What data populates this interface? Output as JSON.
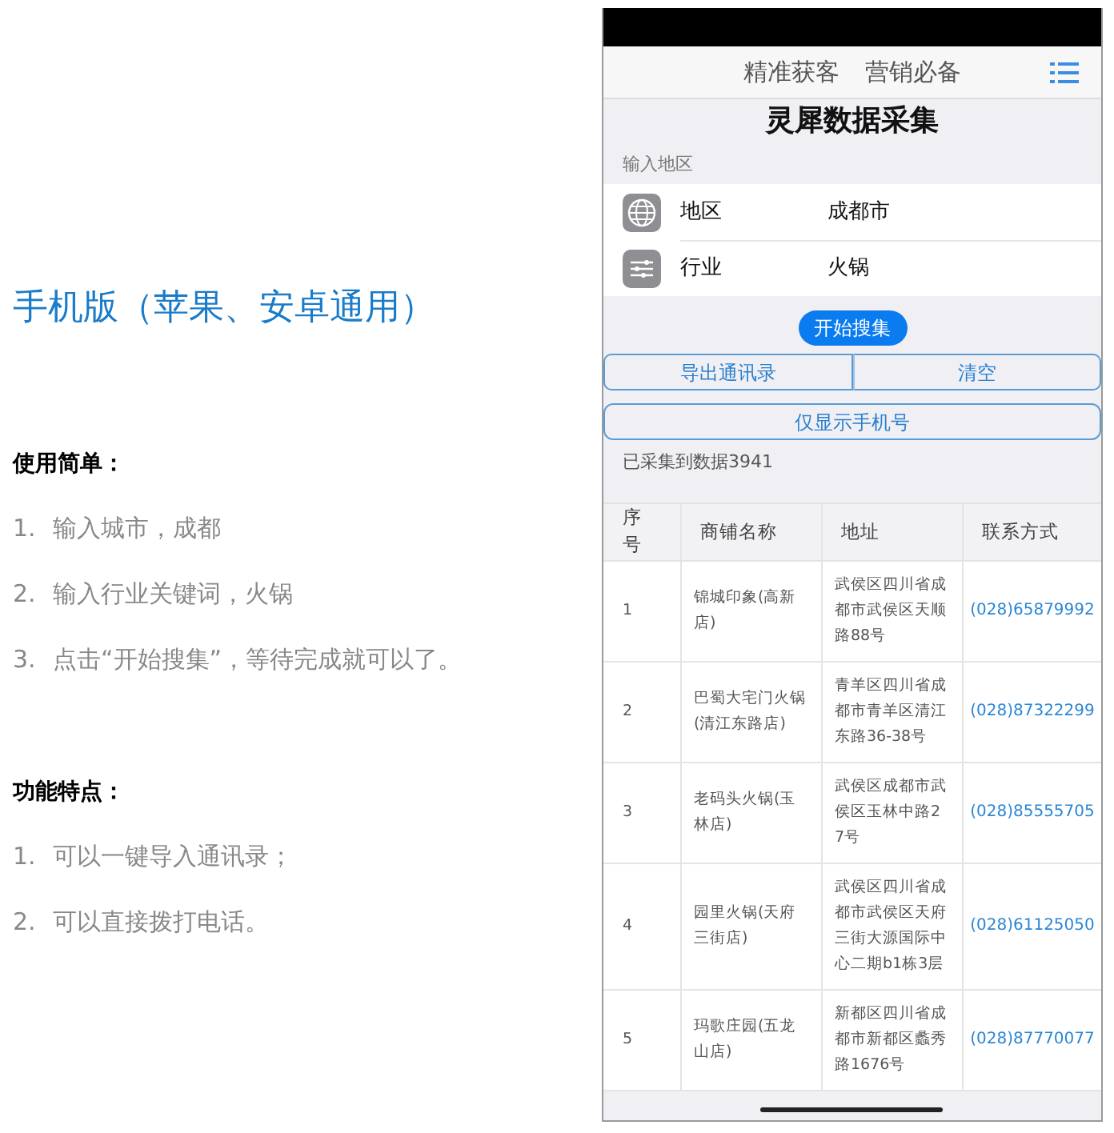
{
  "intro": {
    "title": "手机版（苹果、安卓通用）",
    "sections": [
      {
        "heading": "使用简单：",
        "items": [
          {
            "number": "1.",
            "text": "输入城市，成都"
          },
          {
            "number": "2.",
            "text": "输入行业关键词，火锅"
          },
          {
            "number": "3.",
            "text": "点击“开始搜集”，等待完成就可以了。"
          }
        ]
      },
      {
        "heading": "功能特点：",
        "items": [
          {
            "number": "1.",
            "text": "可以一键导入通讯录；"
          },
          {
            "number": "2.",
            "text": "可以直接拨打电话。"
          }
        ]
      }
    ]
  },
  "phone": {
    "taglines": [
      "精准获客",
      "营销必备"
    ],
    "app_title": "灵犀数据采集",
    "section_label": "输入地区",
    "fields": [
      {
        "kind": "globe",
        "label": "地区",
        "value": "成都市"
      },
      {
        "kind": "sliders",
        "label": "行业",
        "value": "火锅"
      }
    ],
    "search_button": "开始搜集",
    "action_buttons": [
      "导出通讯录",
      "清空"
    ],
    "filter_button": "仅显示手机号",
    "count_text": "已采集到数据3941",
    "table": {
      "columns": [
        "序号",
        "商铺名称",
        "地址",
        "联系方式"
      ],
      "rows": [
        [
          "1",
          "锦城印象(高新店)",
          "武侯区四川省成都市武侯区天顺路88号",
          "(028)65879992"
        ],
        [
          "2",
          "巴蜀大宅门火锅(清江东路店)",
          "青羊区四川省成都市青羊区清江东路36-38号",
          "(028)87322299"
        ],
        [
          "3",
          "老码头火锅(玉林店)",
          "武侯区成都市武侯区玉林中路27号",
          "(028)85555705"
        ],
        [
          "4",
          "园里火锅(天府三街店)",
          "武侯区四川省成都市武侯区天府三街大源国际中心二期b1栋3层",
          "(028)61125050"
        ],
        [
          "5",
          "玛歌庄园(五龙山店)",
          "新都区四川省成都市新都区蠡秀路1676号",
          "(028)87770077"
        ]
      ]
    }
  }
}
